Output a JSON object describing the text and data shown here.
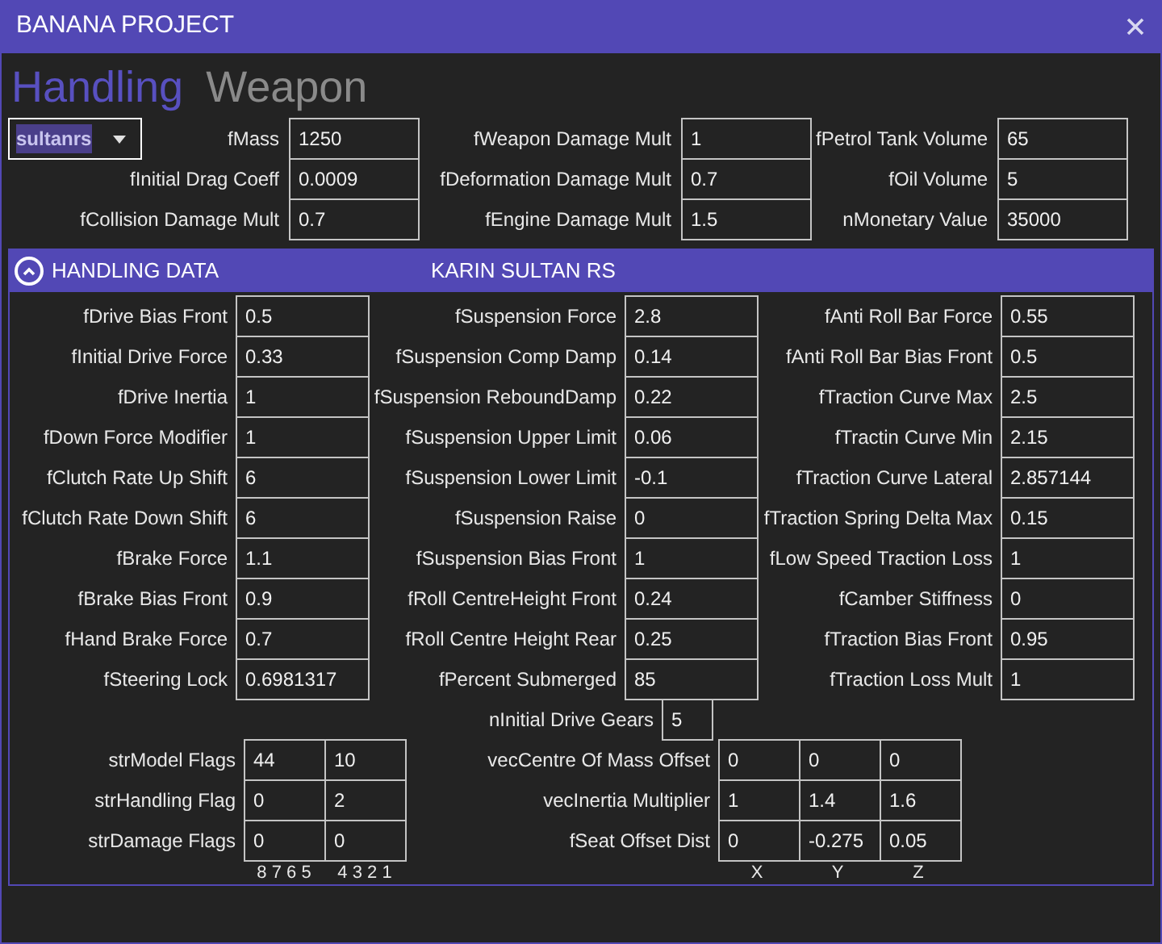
{
  "window": {
    "title": "BANANA PROJECT"
  },
  "tabs": [
    {
      "label": "Handling",
      "selected": true
    },
    {
      "label": "Weapon",
      "selected": false
    }
  ],
  "vehicle_dropdown": {
    "value": "sultanrs"
  },
  "top_fields": [
    [
      {
        "label": "fMass",
        "value": "1250"
      },
      {
        "label": "fWeapon Damage Mult",
        "value": "1"
      },
      {
        "label": "fPetrol Tank Volume",
        "value": "65"
      }
    ],
    [
      {
        "label": "fInitial Drag Coeff",
        "value": "0.0009"
      },
      {
        "label": "fDeformation Damage Mult",
        "value": "0.7"
      },
      {
        "label": "fOil Volume",
        "value": "5"
      }
    ],
    [
      {
        "label": "fCollision Damage Mult",
        "value": "0.7"
      },
      {
        "label": "fEngine Damage Mult",
        "value": "1.5"
      },
      {
        "label": "nMonetary Value",
        "value": "35000"
      }
    ]
  ],
  "section": {
    "title": "HANDLING DATA",
    "subtitle": "KARIN SULTAN RS",
    "expanded": true
  },
  "handling_rows": [
    [
      {
        "label": "fDrive Bias Front",
        "value": "0.5"
      },
      {
        "label": "fSuspension Force",
        "value": "2.8"
      },
      {
        "label": "fAnti Roll Bar Force",
        "value": "0.55"
      }
    ],
    [
      {
        "label": "fInitial Drive Force",
        "value": "0.33"
      },
      {
        "label": "fSuspension Comp Damp",
        "value": "0.14"
      },
      {
        "label": "fAnti Roll Bar Bias Front",
        "value": "0.5"
      }
    ],
    [
      {
        "label": "fDrive Inertia",
        "value": "1"
      },
      {
        "label": "fSuspension ReboundDamp",
        "value": "0.22"
      },
      {
        "label": "fTraction Curve Max",
        "value": "2.5"
      }
    ],
    [
      {
        "label": "fDown Force Modifier",
        "value": "1"
      },
      {
        "label": "fSuspension Upper Limit",
        "value": "0.06"
      },
      {
        "label": "fTractin Curve Min",
        "value": "2.15"
      }
    ],
    [
      {
        "label": "fClutch Rate Up Shift",
        "value": "6"
      },
      {
        "label": "fSuspension Lower Limit",
        "value": "-0.1"
      },
      {
        "label": "fTraction Curve Lateral",
        "value": "2.857144"
      }
    ],
    [
      {
        "label": "fClutch Rate Down Shift",
        "value": "6"
      },
      {
        "label": "fSuspension Raise",
        "value": "0"
      },
      {
        "label": "fTraction Spring Delta Max",
        "value": "0.15"
      }
    ],
    [
      {
        "label": "fBrake Force",
        "value": "1.1"
      },
      {
        "label": "fSuspension Bias Front",
        "value": "1"
      },
      {
        "label": "fLow Speed Traction Loss",
        "value": "1"
      }
    ],
    [
      {
        "label": "fBrake Bias Front",
        "value": "0.9"
      },
      {
        "label": "fRoll CentreHeight Front",
        "value": "0.24"
      },
      {
        "label": "fCamber Stiffness",
        "value": "0"
      }
    ],
    [
      {
        "label": "fHand Brake Force",
        "value": "0.7"
      },
      {
        "label": "fRoll Centre Height Rear",
        "value": "0.25"
      },
      {
        "label": "fTraction Bias Front",
        "value": "0.95"
      }
    ],
    [
      {
        "label": "fSteering Lock",
        "value": "0.6981317"
      },
      {
        "label": "fPercent Submerged",
        "value": "85"
      },
      {
        "label": "fTraction Loss Mult",
        "value": "1"
      }
    ]
  ],
  "gears": {
    "label": "nInitial Drive Gears",
    "value": "5"
  },
  "flag_rows": [
    {
      "label": "strModel Flags",
      "values": [
        "44",
        "10"
      ]
    },
    {
      "label": "strHandling Flag",
      "values": [
        "0",
        "2"
      ]
    },
    {
      "label": "strDamage Flags",
      "values": [
        "0",
        "0"
      ]
    }
  ],
  "flag_axis": [
    "8 7 6 5",
    "4 3 2 1"
  ],
  "vector_rows": [
    {
      "label": "vecCentre Of Mass Offset",
      "values": [
        "0",
        "0",
        "0"
      ]
    },
    {
      "label": "vecInertia Multiplier",
      "values": [
        "1",
        "1.4",
        "1.6"
      ]
    },
    {
      "label": "fSeat Offset Dist",
      "values": [
        "0",
        "-0.275",
        "0.05"
      ]
    }
  ],
  "vector_axis": [
    "X",
    "Y",
    "Z"
  ]
}
